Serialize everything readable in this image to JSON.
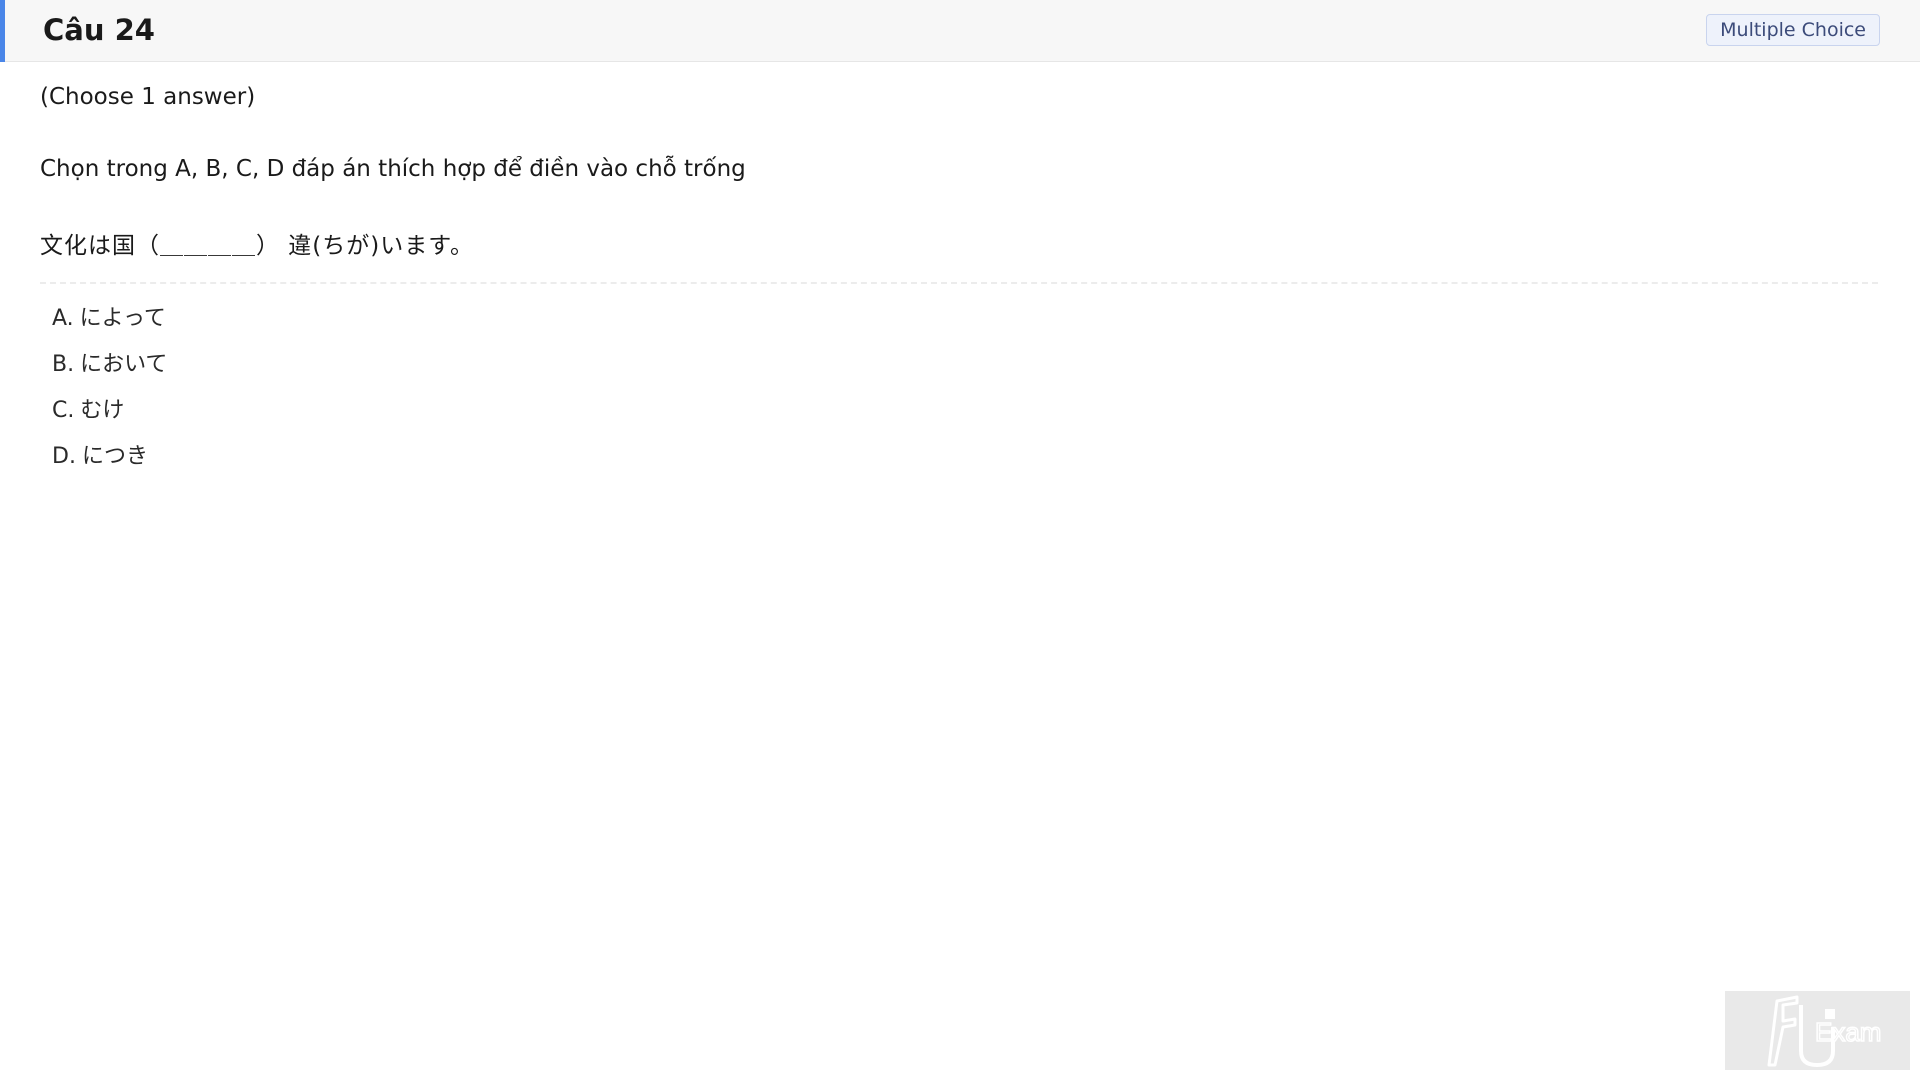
{
  "header": {
    "title": "Câu 24",
    "badge": "Multiple Choice"
  },
  "question": {
    "instruction": "(Choose 1 answer)",
    "prompt": "Chọn trong A, B, C, D đáp án thích hợp để điền vào chỗ trống",
    "sentence": "文化は国（＿＿＿＿） 違(ちが)います。"
  },
  "options": [
    {
      "letter": "A.",
      "text": "によって"
    },
    {
      "letter": "B.",
      "text": "において"
    },
    {
      "letter": "C.",
      "text": "むけ"
    },
    {
      "letter": "D.",
      "text": "につき"
    }
  ],
  "logo": {
    "text": "FU Exam"
  },
  "colors": {
    "accent": "#4a86e8",
    "badge_bg": "#eef2fb",
    "badge_text": "#3c4b7a"
  }
}
